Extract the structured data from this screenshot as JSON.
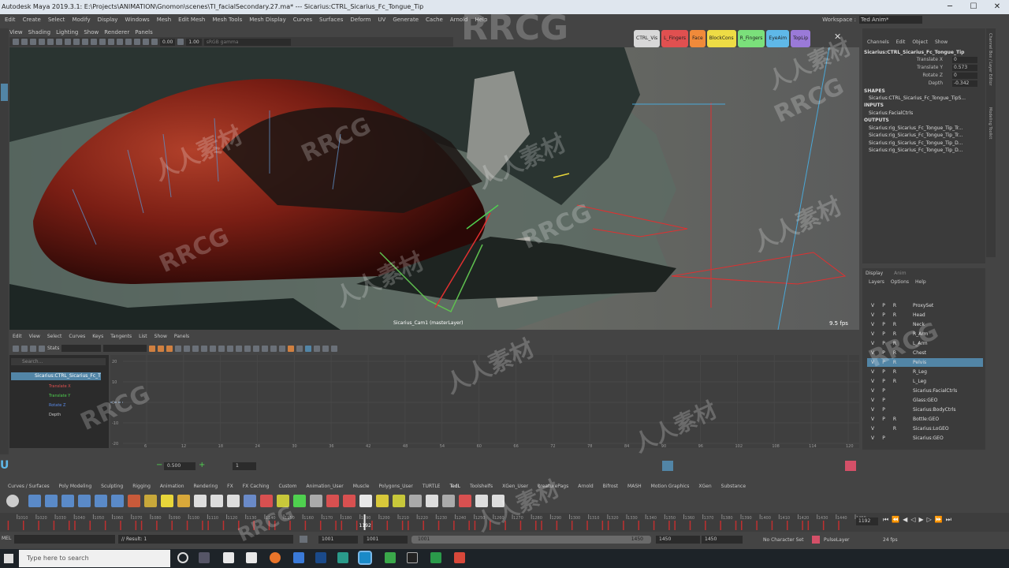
{
  "title_bar": {
    "text": "Autodesk Maya 2019.3.1: E:\\Projects\\ANIMATION\\Gnomon\\scenes\\TI_facialSecondary.27.ma*  ---  Sicarius:CTRL_Sicarius_Fc_Tongue_Tip",
    "minimize": "─",
    "maximize": "☐",
    "close": "✕"
  },
  "main_menu": [
    "Edit",
    "Create",
    "Select",
    "Modify",
    "Display",
    "Windows",
    "Mesh",
    "Edit Mesh",
    "Mesh Tools",
    "Mesh Display",
    "Curves",
    "Surfaces",
    "Deform",
    "UV",
    "Generate",
    "Cache",
    "Arnold",
    "Help"
  ],
  "workspace": {
    "label": "Workspace :",
    "value": "Ted Anim*"
  },
  "viewport": {
    "menu": [
      "View",
      "Shading",
      "Lighting",
      "Show",
      "Renderer",
      "Panels"
    ],
    "toolbar": {
      "field1": "0.00",
      "field2": "1.00",
      "color_space": "sRGB gamma"
    },
    "camera_label": "Sicarius_Cam1 (masterLayer)",
    "fps": "9.5 fps"
  },
  "vis_shelf": {
    "buttons": [
      {
        "label": "CTRL_Vis",
        "color": "#d8d8d8"
      },
      {
        "label": "L_Fingers",
        "color": "#e05050"
      },
      {
        "label": "Face",
        "color": "#f08a3a"
      },
      {
        "label": "BlockCons",
        "color": "#eedc45"
      },
      {
        "label": "R_Fingers",
        "color": "#7be07b"
      },
      {
        "label": "EyeAim",
        "color": "#5fb8e8"
      },
      {
        "label": "TopLip",
        "color": "#9a7ad8"
      }
    ],
    "close": "✕"
  },
  "channel_box": {
    "menu": [
      "Channels",
      "Edit",
      "Object",
      "Show"
    ],
    "node": "Sicarius:CTRL_Sicarius_Fc_Tongue_Tip",
    "attributes": [
      {
        "name": "Translate X",
        "value": "0"
      },
      {
        "name": "Translate Y",
        "value": "0.573"
      },
      {
        "name": "Rotate Z",
        "value": "0"
      },
      {
        "name": "Depth",
        "value": "-0.342"
      }
    ],
    "shapes_header": "SHAPES",
    "shape": "Sicarius:CTRL_Sicarius_Fc_Tongue_TipS...",
    "inputs_header": "INPUTS",
    "input": "Sicarius:FacialCtrls",
    "outputs_header": "OUTPUTS",
    "outputs": [
      "Sicarius:rig_Sicarius_Fc_Tongue_Tip_Tr...",
      "Sicarius:rig_Sicarius_Fc_Tongue_Tip_Tr...",
      "Sicarius:rig_Sicarius_Fc_Tongue_Tip_D...",
      "Sicarius:rig_Sicarius_Fc_Tongue_Tip_D..."
    ]
  },
  "right_tabs": [
    "Channel Box / Layer Editor",
    "Modeling Toolkit"
  ],
  "layer_editor": {
    "tabs": [
      "Display",
      "Anim"
    ],
    "menu": [
      "Layers",
      "Options",
      "Help"
    ],
    "layers": [
      {
        "v": "V",
        "p": "P",
        "r": "R",
        "name": "ProxySet"
      },
      {
        "v": "V",
        "p": "P",
        "r": "R",
        "name": "Head"
      },
      {
        "v": "V",
        "p": "P",
        "r": "R",
        "name": "Neck"
      },
      {
        "v": "V",
        "p": "P",
        "r": "R",
        "name": "R_Arm"
      },
      {
        "v": "V",
        "p": "P",
        "r": "R",
        "name": "L_Arm"
      },
      {
        "v": "V",
        "p": "P",
        "r": "R",
        "name": "Chest"
      },
      {
        "v": "V",
        "p": "P",
        "r": "R",
        "name": "Pelvis"
      },
      {
        "v": "V",
        "p": "P",
        "r": "R",
        "name": "R_Leg"
      },
      {
        "v": "V",
        "p": "P",
        "r": "R",
        "name": "L_Leg"
      },
      {
        "v": "V",
        "p": "P",
        "r": "",
        "name": "Sicarius:FacialCtrls"
      },
      {
        "v": "V",
        "p": "P",
        "r": "",
        "name": "Glass:GEO"
      },
      {
        "v": "V",
        "p": "P",
        "r": "",
        "name": "Sicarius:BodyCtrls"
      },
      {
        "v": "V",
        "p": "P",
        "r": "R",
        "name": "Bottle:GEO"
      },
      {
        "v": "V",
        "p": "",
        "r": "R",
        "name": "Sicarius:LoGEO"
      },
      {
        "v": "V",
        "p": "P",
        "r": "",
        "name": "Sicarius:GEO"
      }
    ]
  },
  "graph_editor": {
    "menu": [
      "Edit",
      "View",
      "Select",
      "Curves",
      "Keys",
      "Tangents",
      "List",
      "Show",
      "Panels"
    ],
    "stats_label": "Stats",
    "search_placeholder": "Search...",
    "node": "Sicarius:CTRL_Sicarius_Fc_T",
    "channels": [
      {
        "name": "Translate X",
        "color": "#e05050"
      },
      {
        "name": "Translate Y",
        "color": "#4fd04f"
      },
      {
        "name": "Rotate Z",
        "color": "#5a8ae8"
      },
      {
        "name": "Depth",
        "color": "#c8c8c8"
      }
    ],
    "y_ticks": [
      "20",
      "10",
      "0",
      "-10",
      "-20"
    ],
    "x_ticks": [
      "6",
      "12",
      "18",
      "24",
      "30",
      "36",
      "42",
      "48",
      "54",
      "60",
      "66",
      "72",
      "78",
      "84",
      "90",
      "96",
      "102",
      "108",
      "114",
      "120"
    ]
  },
  "status_line": {
    "field1": "0.500",
    "field2": "1"
  },
  "shelf_tabs": [
    "Curves / Surfaces",
    "Poly Modeling",
    "Sculpting",
    "Rigging",
    "Animation",
    "Rendering",
    "FX",
    "FX Caching",
    "Custom",
    "Animation_User",
    "Muscle",
    "Polygons_User",
    "TURTLE",
    "TedL",
    "Toolshelfs",
    "XGen_User",
    "creaturePags",
    "Arnold",
    "Bifrost",
    "MASH",
    "Motion Graphics",
    "XGen",
    "Substance"
  ],
  "time_slider": {
    "ticks": [
      "1010",
      "1020",
      "1030",
      "1040",
      "1050",
      "1060",
      "1070",
      "1080",
      "1090",
      "1100",
      "1110",
      "1120",
      "1130",
      "1140",
      "1150",
      "1160",
      "1170",
      "1180",
      "1190",
      "1200",
      "1210",
      "1220",
      "1230",
      "1240",
      "1250",
      "1260",
      "1270",
      "1280",
      "1290",
      "1300",
      "1310",
      "1320",
      "1330",
      "1340",
      "1350",
      "1360",
      "1370",
      "1380",
      "1390",
      "1400",
      "1410",
      "1420",
      "1430",
      "1440",
      "1450"
    ],
    "current_frame": "1192",
    "frame_field": "1192"
  },
  "range_slider": {
    "start": "1001",
    "anim_start": "1001",
    "range_start_label": "1001",
    "range_end_label": "1450",
    "anim_end": "1450",
    "end": "1450",
    "character_set": "No Character Set",
    "anim_layer": "PulseLayer",
    "fps": "24 fps"
  },
  "command_line": {
    "label": "MEL",
    "result": "// Result: 1"
  },
  "taskbar": {
    "search_placeholder": "Type here to search"
  },
  "watermarks": [
    "RRCG",
    "人人素材",
    "RRCG",
    "人人素材",
    "RRCG",
    "人人素材",
    "RRCG",
    "人人素材",
    "RRCG",
    "人人素材",
    "RRCG",
    "人人素材",
    "人人素材",
    "RRCG",
    "人人素材",
    "RRCG"
  ]
}
